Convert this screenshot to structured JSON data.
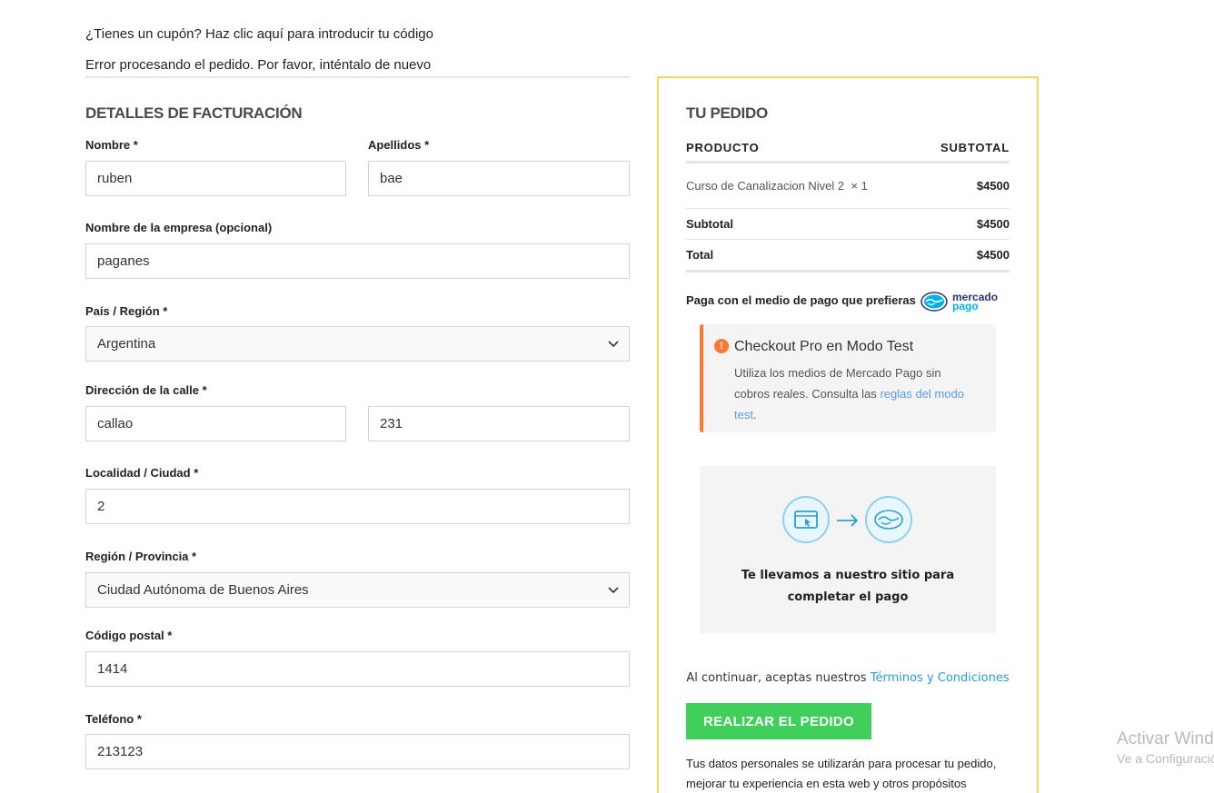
{
  "notices": {
    "coupon": "¿Tienes un cupón? Haz clic aquí para introducir tu código",
    "error": "Error procesando el pedido. Por favor, inténtalo de nuevo"
  },
  "billing": {
    "title": "DETALLES DE FACTURACIÓN",
    "required_mark": "*",
    "first_name": {
      "label": "Nombre",
      "value": "ruben"
    },
    "last_name": {
      "label": "Apellidos",
      "value": "bae"
    },
    "company": {
      "label": "Nombre de la empresa (opcional)",
      "value": "paganes"
    },
    "country": {
      "label": "País / Región",
      "value": "Argentina"
    },
    "street": {
      "label": "Dirección de la calle",
      "value": "callao",
      "number": "231"
    },
    "city": {
      "label": "Localidad / Ciudad",
      "value": "2"
    },
    "state": {
      "label": "Región / Provincia",
      "value": "Ciudad Autónoma de Buenos Aires"
    },
    "postcode": {
      "label": "Código postal",
      "value": "1414"
    },
    "phone": {
      "label": "Teléfono",
      "value": "213123"
    }
  },
  "order": {
    "title": "TU PEDIDO",
    "col_product": "PRODUCTO",
    "col_subtotal": "SUBTOTAL",
    "item": {
      "name": "Curso de Canalizacion Nivel 2",
      "qty": "× 1",
      "price": "$4500"
    },
    "subtotal_label": "Subtotal",
    "subtotal_value": "$4500",
    "total_label": "Total",
    "total_value": "$4500"
  },
  "payment": {
    "label": "Paga con el medio de pago que prefieras",
    "logo_text_1": "mercado",
    "logo_text_2": "pago",
    "notice_title": "Checkout Pro en Modo Test",
    "notice_body": "Utiliza los medios de Mercado Pago sin cobros reales. Consulta las",
    "notice_link": "reglas del modo test",
    "notice_end": ".",
    "redirect_text": "Te llevamos a nuestro sitio para completar el pago",
    "terms_text": "Al continuar, aceptas nuestros",
    "terms_link": "Términos y Condiciones",
    "button": "REALIZAR EL PEDIDO",
    "privacy": "Tus datos personales se utilizarán para procesar tu pedido, mejorar tu experiencia en esta web y otros propósitos"
  },
  "watermark": {
    "line1": "Activar Windows",
    "line2": "Ve a Configuración para activar Windows."
  },
  "colors": {
    "panel_border": "#f5d85a",
    "button": "#3fcf5a",
    "notice_accent": "#ff7733",
    "link": "#5c9cea"
  }
}
